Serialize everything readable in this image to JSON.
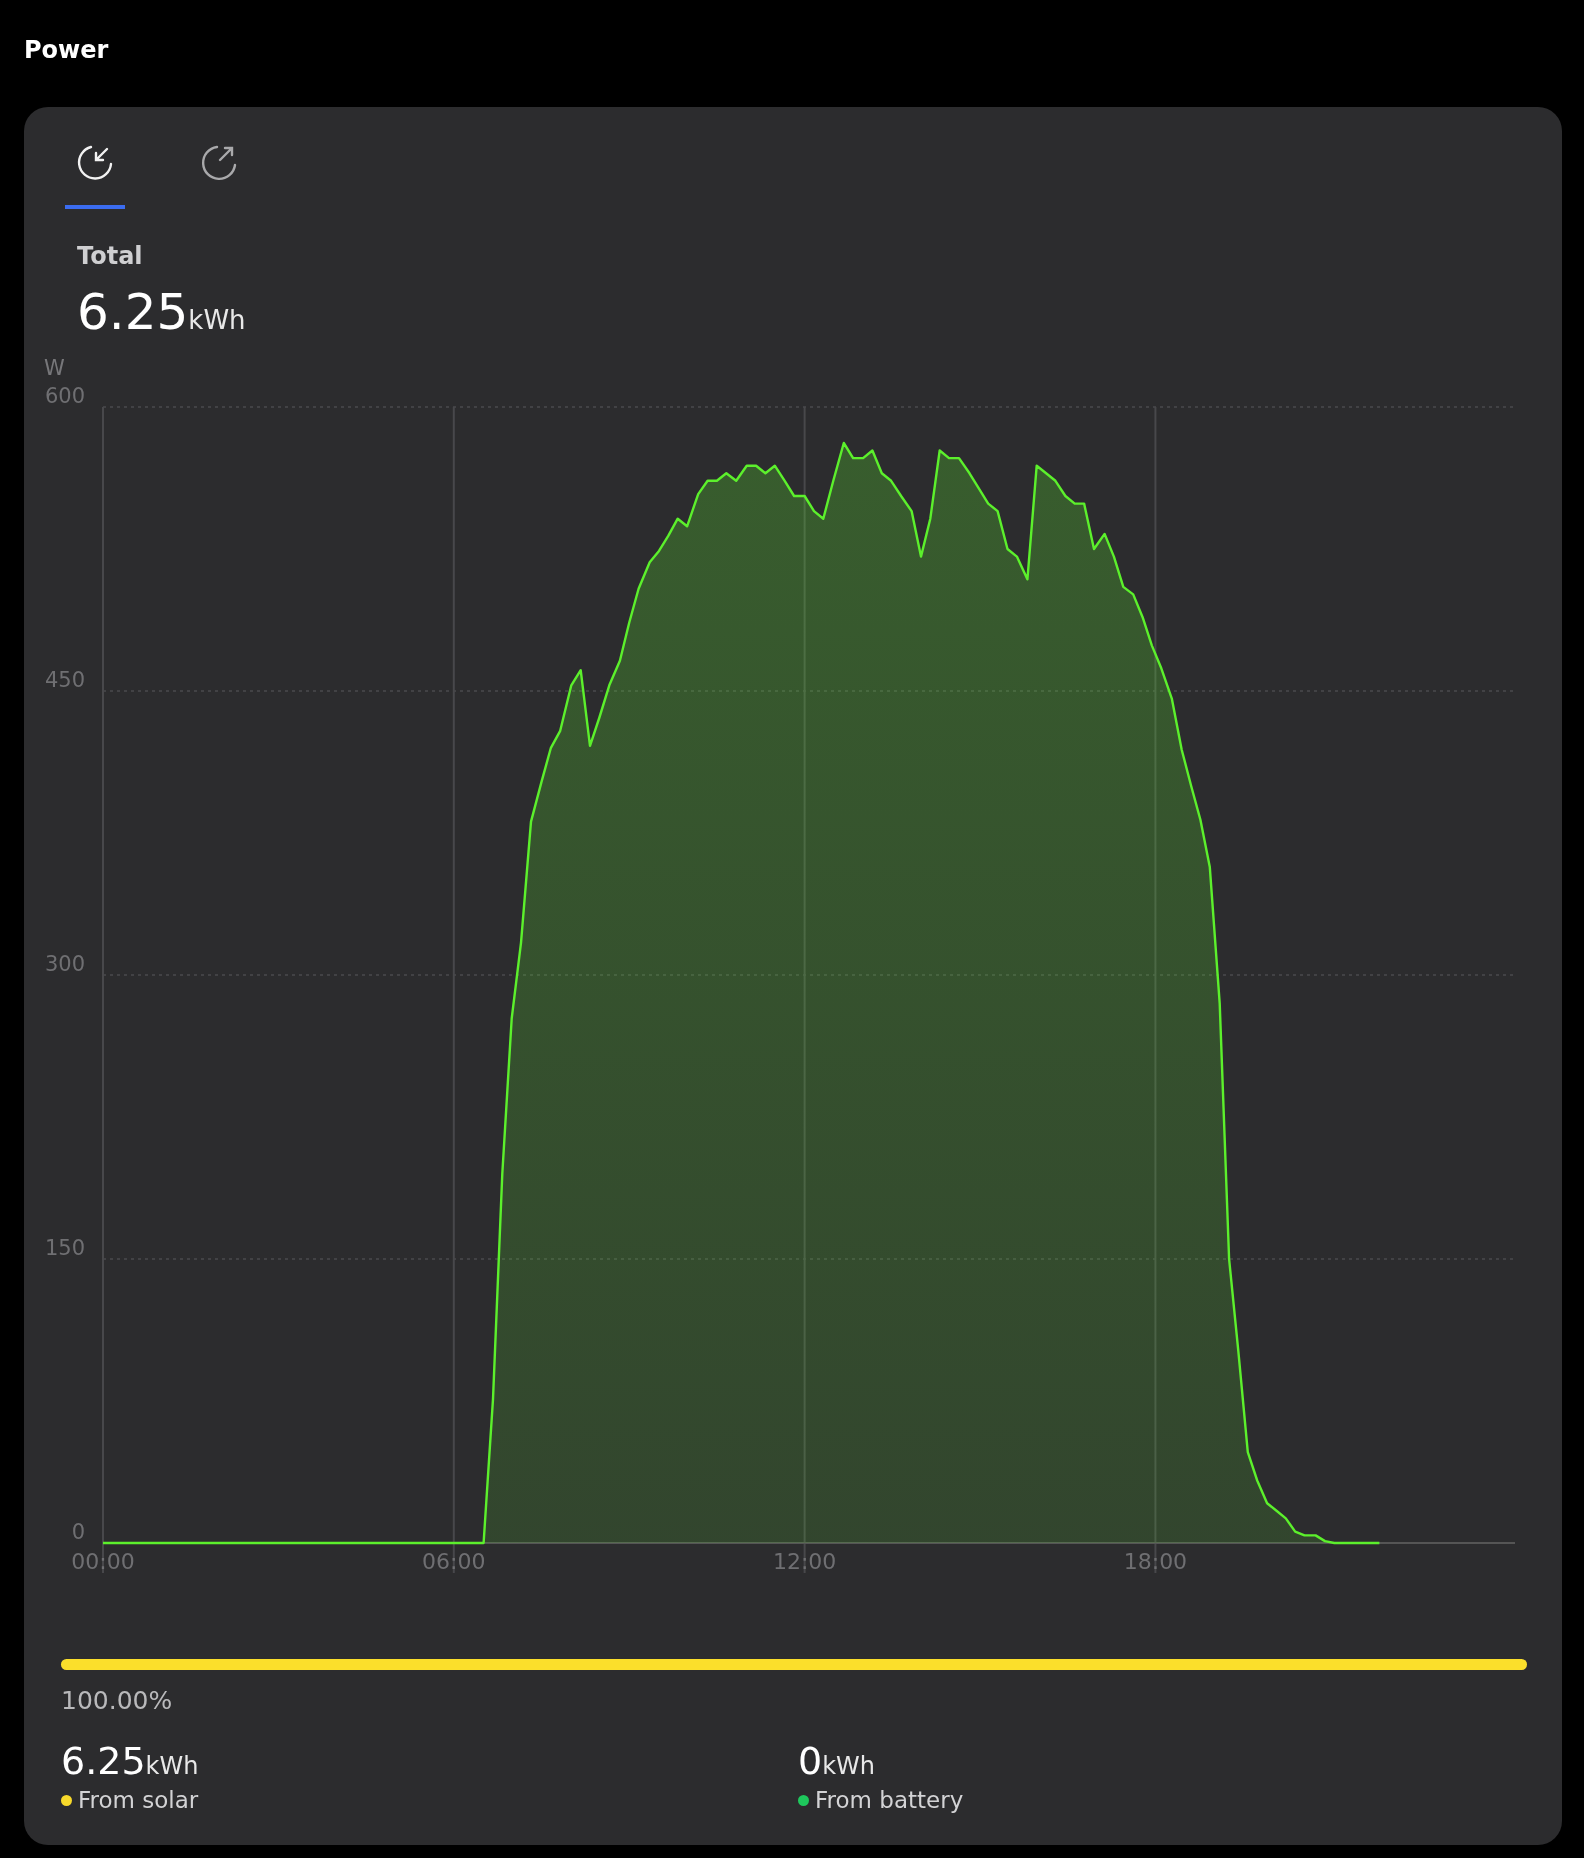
{
  "title": "Power",
  "tabs": [
    {
      "kind": "import",
      "selected": true
    },
    {
      "kind": "export",
      "selected": false
    }
  ],
  "total": {
    "label": "Total",
    "value": "6.25",
    "unit": "kWh"
  },
  "chart": {
    "chart_data": {
      "type": "area",
      "grid": true,
      "ylabel": "W",
      "xlim": [
        0,
        24.15
      ],
      "ylim": [
        0,
        600
      ],
      "yticks": [
        0,
        150,
        300,
        450,
        600
      ],
      "xticks": [
        {
          "value": 0,
          "label": "00:00"
        },
        {
          "value": 6,
          "label": "06:00"
        },
        {
          "value": 12,
          "label": "12:00"
        },
        {
          "value": 18,
          "label": "18:00"
        }
      ],
      "x": [
        0,
        6.51,
        6.67,
        6.83,
        6.99,
        7.15,
        7.32,
        7.5,
        7.66,
        7.82,
        8.01,
        8.17,
        8.33,
        8.49,
        8.66,
        8.84,
        9,
        9.16,
        9.35,
        9.51,
        9.67,
        9.83,
        9.99,
        10.18,
        10.34,
        10.5,
        10.66,
        10.83,
        11.01,
        11.17,
        11.33,
        11.49,
        11.66,
        11.82,
        12,
        12.16,
        12.32,
        12.49,
        12.67,
        12.83,
        13,
        13.16,
        13.32,
        13.48,
        13.65,
        13.83,
        13.99,
        14.15,
        14.31,
        14.47,
        14.64,
        14.82,
        14.98,
        15.14,
        15.3,
        15.47,
        15.63,
        15.81,
        15.97,
        16.13,
        16.29,
        16.46,
        16.62,
        16.78,
        16.95,
        17.13,
        17.29,
        17.45,
        17.62,
        17.78,
        17.94,
        18.1,
        18.28,
        18.45,
        18.61,
        18.77,
        18.93,
        19.1,
        19.26,
        19.42,
        19.58,
        19.74,
        19.91,
        20.07,
        20.23,
        20.39,
        20.55,
        20.74,
        20.9,
        21.06,
        21.83
      ],
      "series": [
        {
          "color": "#5cf02c",
          "values": [
            0,
            0,
            76,
            195,
            277,
            317,
            381,
            402,
            420,
            429,
            453,
            461,
            421,
            436,
            453,
            466,
            486,
            504,
            518,
            524,
            532,
            541,
            537,
            554,
            561,
            561,
            565,
            561,
            569,
            569,
            565,
            569,
            561,
            553,
            553,
            545,
            541,
            561,
            581,
            573,
            573,
            577,
            565,
            561,
            553,
            545,
            521,
            541,
            577,
            573,
            573,
            565,
            557,
            549,
            545,
            525,
            521,
            509,
            569,
            565,
            561,
            553,
            549,
            549,
            525,
            533,
            521,
            505,
            501,
            489,
            474,
            462,
            446,
            419,
            400,
            382,
            357,
            285,
            150,
            101,
            48,
            33,
            21,
            17,
            13,
            6,
            4,
            4,
            1,
            0,
            0
          ]
        }
      ]
    }
  },
  "share": {
    "level": 1,
    "reading": "100.00%",
    "color": "#fbdf2b"
  },
  "sources": [
    {
      "value": "6.25",
      "unit": "kWh",
      "label": "From solar",
      "color": "#f7d92b"
    },
    {
      "value": "0",
      "unit": "kWh",
      "label": "From battery",
      "color": "#1ec75c"
    }
  ]
}
